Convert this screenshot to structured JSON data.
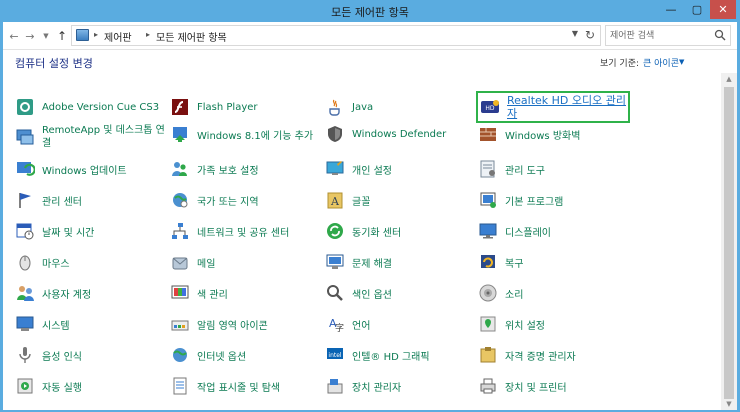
{
  "window": {
    "title": "모든 제어판 항목",
    "minimize": "—",
    "maximize": "▢",
    "close": "✕"
  },
  "nav": {
    "back": "←",
    "forward": "→",
    "recent": "▼",
    "up": "↑"
  },
  "address": {
    "crumbs": [
      "제어판",
      "모든 제어판 항목"
    ],
    "separator": "▸",
    "dropdown": "▼",
    "refresh": "↻"
  },
  "search": {
    "placeholder": "제어판 검색"
  },
  "heading": "컴퓨터 설정 변경",
  "viewby": {
    "label": "보기 기준:",
    "value": "큰 아이콘",
    "arrow": "▼"
  },
  "scrollbar": {
    "up": "▲",
    "down": "▼"
  },
  "items": [
    [
      "Adobe Version Cue CS3",
      "Flash Player",
      "Java",
      "Realtek HD 오디오 관리자"
    ],
    [
      "RemoteApp 및 데스크톱 연결",
      "Windows 8.1에 기능 추가",
      "Windows Defender",
      "Windows 방화벽"
    ],
    [
      "Windows 업데이트",
      "가족 보호 설정",
      "개인 설정",
      "관리 도구"
    ],
    [
      "관리 센터",
      "국가 또는 지역",
      "글꼴",
      "기본 프로그램"
    ],
    [
      "날짜 및 시간",
      "네트워크 및 공유 센터",
      "동기화 센터",
      "디스플레이"
    ],
    [
      "마우스",
      "메일",
      "문제 해결",
      "복구"
    ],
    [
      "사용자 계정",
      "색 관리",
      "색인 옵션",
      "소리"
    ],
    [
      "시스템",
      "알림 영역 아이콘",
      "언어",
      "위치 설정"
    ],
    [
      "음성 인식",
      "인터넷 옵션",
      "인텔® HD 그래픽",
      "자격 증명 관리자"
    ],
    [
      "자동 실행",
      "작업 표시줄 및 탐색",
      "장치 관리자",
      "장치 및 프린터"
    ]
  ],
  "selected": {
    "row": 0,
    "col": 3
  }
}
